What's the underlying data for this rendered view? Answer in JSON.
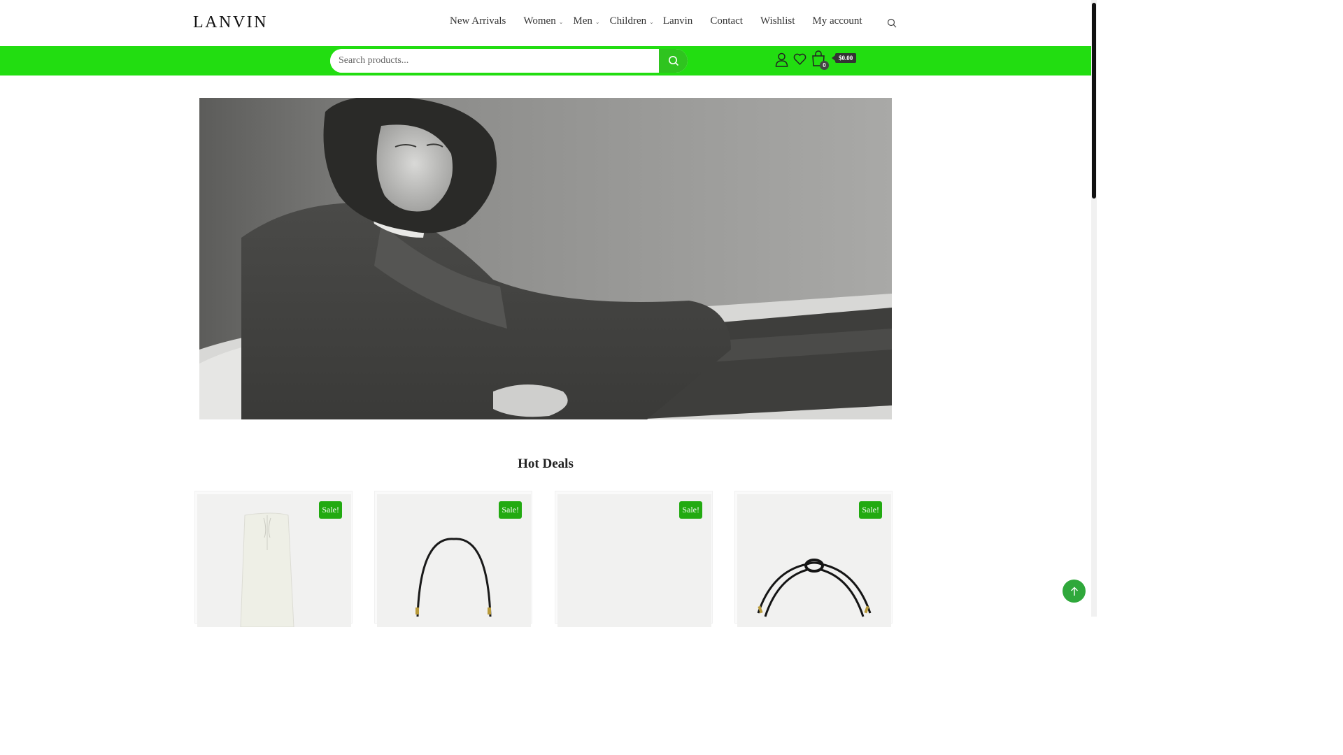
{
  "brand": {
    "logo_text": "LANVIN"
  },
  "nav": {
    "items": [
      {
        "label": "New Arrivals",
        "has_dropdown": false
      },
      {
        "label": "Women",
        "has_dropdown": true
      },
      {
        "label": "Men",
        "has_dropdown": true
      },
      {
        "label": "Children",
        "has_dropdown": true
      },
      {
        "label": "Lanvin",
        "has_dropdown": false
      },
      {
        "label": "Contact",
        "has_dropdown": false
      },
      {
        "label": "Wishlist",
        "has_dropdown": false
      },
      {
        "label": "My account",
        "has_dropdown": false
      }
    ],
    "search_icon": "search-icon"
  },
  "colors": {
    "accent_green": "#22dd11",
    "button_green": "#2fc41f",
    "sale_green": "#22aa11",
    "back_to_top": "#2fa83b"
  },
  "search": {
    "placeholder": "Search products...",
    "value": ""
  },
  "account": {
    "icons": [
      "user-icon",
      "heart-icon",
      "bag-icon"
    ],
    "cart_count": "0",
    "cart_total": "$0.00"
  },
  "hero": {
    "alt": ""
  },
  "hot_deals": {
    "title": "Hot Deals",
    "products": [
      {
        "badge": "Sale!",
        "image": "white-trousers"
      },
      {
        "badge": "Sale!",
        "image": "black-bag"
      },
      {
        "badge": "Sale!",
        "image": "blank"
      },
      {
        "badge": "Sale!",
        "image": "black-necklace"
      }
    ]
  }
}
